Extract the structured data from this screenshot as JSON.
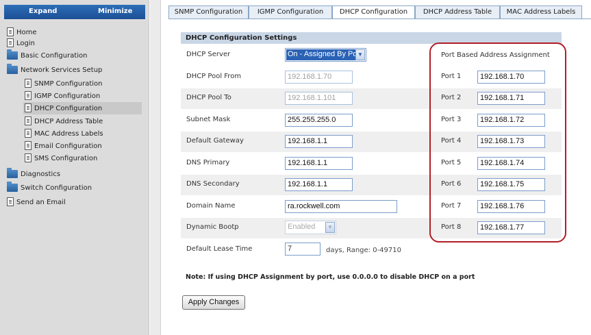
{
  "sidebar": {
    "expand_label": "Expand",
    "minimize_label": "Minimize",
    "items": [
      {
        "label": "Home",
        "icon": "doc-icon"
      },
      {
        "label": "Login",
        "icon": "doc-icon"
      },
      {
        "label": "Basic Configuration",
        "icon": "folder-icon"
      },
      {
        "label": "Network Services Setup",
        "icon": "folder-open-icon"
      },
      {
        "label": "SNMP Configuration",
        "icon": "doc-icon"
      },
      {
        "label": "IGMP Configuration",
        "icon": "doc-icon"
      },
      {
        "label": "DHCP Configuration",
        "icon": "doc-icon"
      },
      {
        "label": "DHCP Address Table",
        "icon": "doc-icon"
      },
      {
        "label": "MAC Address Labels",
        "icon": "doc-icon"
      },
      {
        "label": "Email Configuration",
        "icon": "doc-icon"
      },
      {
        "label": "SMS Configuration",
        "icon": "doc-icon"
      },
      {
        "label": "Diagnostics",
        "icon": "folder-icon"
      },
      {
        "label": "Switch Configuration",
        "icon": "folder-icon"
      },
      {
        "label": "Send an Email",
        "icon": "doc-icon"
      }
    ]
  },
  "tabs": [
    {
      "label": "SNMP Configuration"
    },
    {
      "label": "IGMP Configuration"
    },
    {
      "label": "DHCP Configuration"
    },
    {
      "label": "DHCP Address Table"
    },
    {
      "label": "MAC Address Labels"
    }
  ],
  "active_tab": "DHCP Configuration",
  "section_title": "DHCP Configuration Settings",
  "form": {
    "dhcp_server": {
      "label": "DHCP Server",
      "value": "On - Assigned By Port"
    },
    "pool_from": {
      "label": "DHCP Pool From",
      "value": "192.168.1.70"
    },
    "pool_to": {
      "label": "DHCP Pool To",
      "value": "192.168.1.101"
    },
    "subnet_mask": {
      "label": "Subnet Mask",
      "value": "255.255.255.0"
    },
    "default_gateway": {
      "label": "Default Gateway",
      "value": "192.168.1.1"
    },
    "dns_primary": {
      "label": "DNS Primary",
      "value": "192.168.1.1"
    },
    "dns_secondary": {
      "label": "DNS Secondary",
      "value": "192.168.1.1"
    },
    "domain_name": {
      "label": "Domain Name",
      "value": "ra.rockwell.com"
    },
    "dynamic_bootp": {
      "label": "Dynamic Bootp",
      "value": "Enabled"
    },
    "lease_time": {
      "label": "Default Lease Time",
      "value": "7",
      "suffix": "days, Range: 0-49710"
    }
  },
  "port_assignment": {
    "heading": "Port Based Address Assignment",
    "ports": [
      {
        "label": "Port 1",
        "value": "192.168.1.70"
      },
      {
        "label": "Port 2",
        "value": "192.168.1.71"
      },
      {
        "label": "Port 3",
        "value": "192.168.1.72"
      },
      {
        "label": "Port 4",
        "value": "192.168.1.73"
      },
      {
        "label": "Port 5",
        "value": "192.168.1.74"
      },
      {
        "label": "Port 6",
        "value": "192.168.1.75"
      },
      {
        "label": "Port 7",
        "value": "192.168.1.76"
      },
      {
        "label": "Port 8",
        "value": "192.168.1.77"
      }
    ]
  },
  "note": "Note: If using DHCP Assignment by port, use 0.0.0.0 to disable DHCP on a port",
  "apply_label": "Apply Changes",
  "colors": {
    "header_blue": "#1b4f95",
    "section_header": "#c9d6e6",
    "highlight_outline": "#b11d25",
    "selected_value_bg": "#2a62b5"
  }
}
